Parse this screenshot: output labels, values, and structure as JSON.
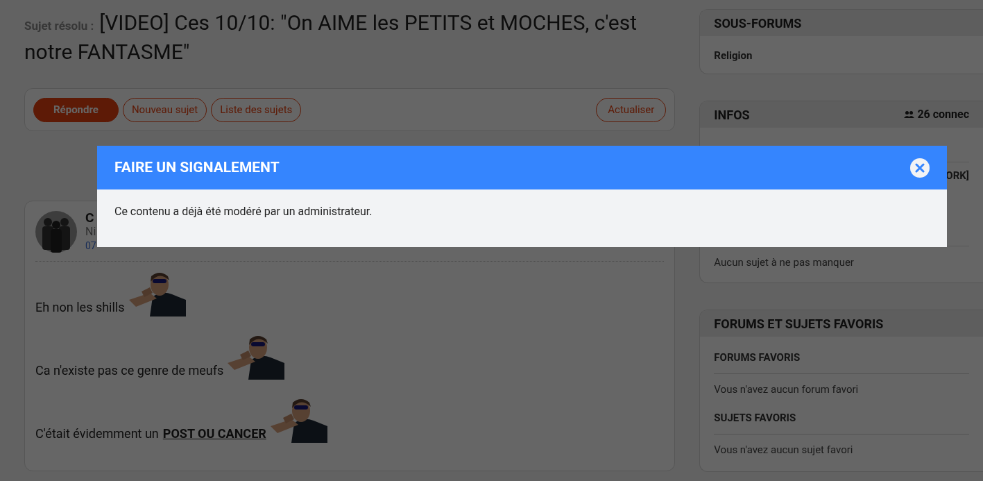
{
  "topic": {
    "status": "Sujet résolu :",
    "title": "[VIDEO] Ces 10/10: \"On AIME les PETITS et MOCHES, c'est notre FANTASME\""
  },
  "actions": [
    {
      "label": "Répondre",
      "kind": "primary"
    },
    {
      "label": "Nouveau sujet",
      "kind": "outline"
    },
    {
      "label": "Liste des sujets",
      "kind": "outline"
    }
  ],
  "refresh": {
    "label": "Actualiser"
  },
  "post": {
    "author": "C",
    "level": "Ni",
    "date": "07",
    "lines": [
      {
        "text": "Eh non les shills"
      },
      {
        "text": "Ca n'existe pas ce genre de meufs"
      },
      {
        "text": "C'était évidemment un",
        "link": "POST OU CANCER"
      }
    ]
  },
  "sub_forums": {
    "title": "SOUS-FORUMS",
    "items": [
      "Religion"
    ]
  },
  "infos": {
    "title": "INFOS",
    "online": "26 connec",
    "item": "ORK]",
    "empty": "Aucun sujet à ne pas manquer"
  },
  "favorites": {
    "title": "FORUMS ET SUJETS FAVORIS",
    "groups": [
      {
        "title": "FORUMS FAVORIS",
        "empty": "Vous n'avez aucun forum favori"
      },
      {
        "title": "SUJETS FAVORIS",
        "empty": "Vous n'avez aucun sujet favori"
      }
    ]
  },
  "modal": {
    "title": "FAIRE UN SIGNALEMENT",
    "message": "Ce contenu a déjà été modéré par un administrateur."
  }
}
